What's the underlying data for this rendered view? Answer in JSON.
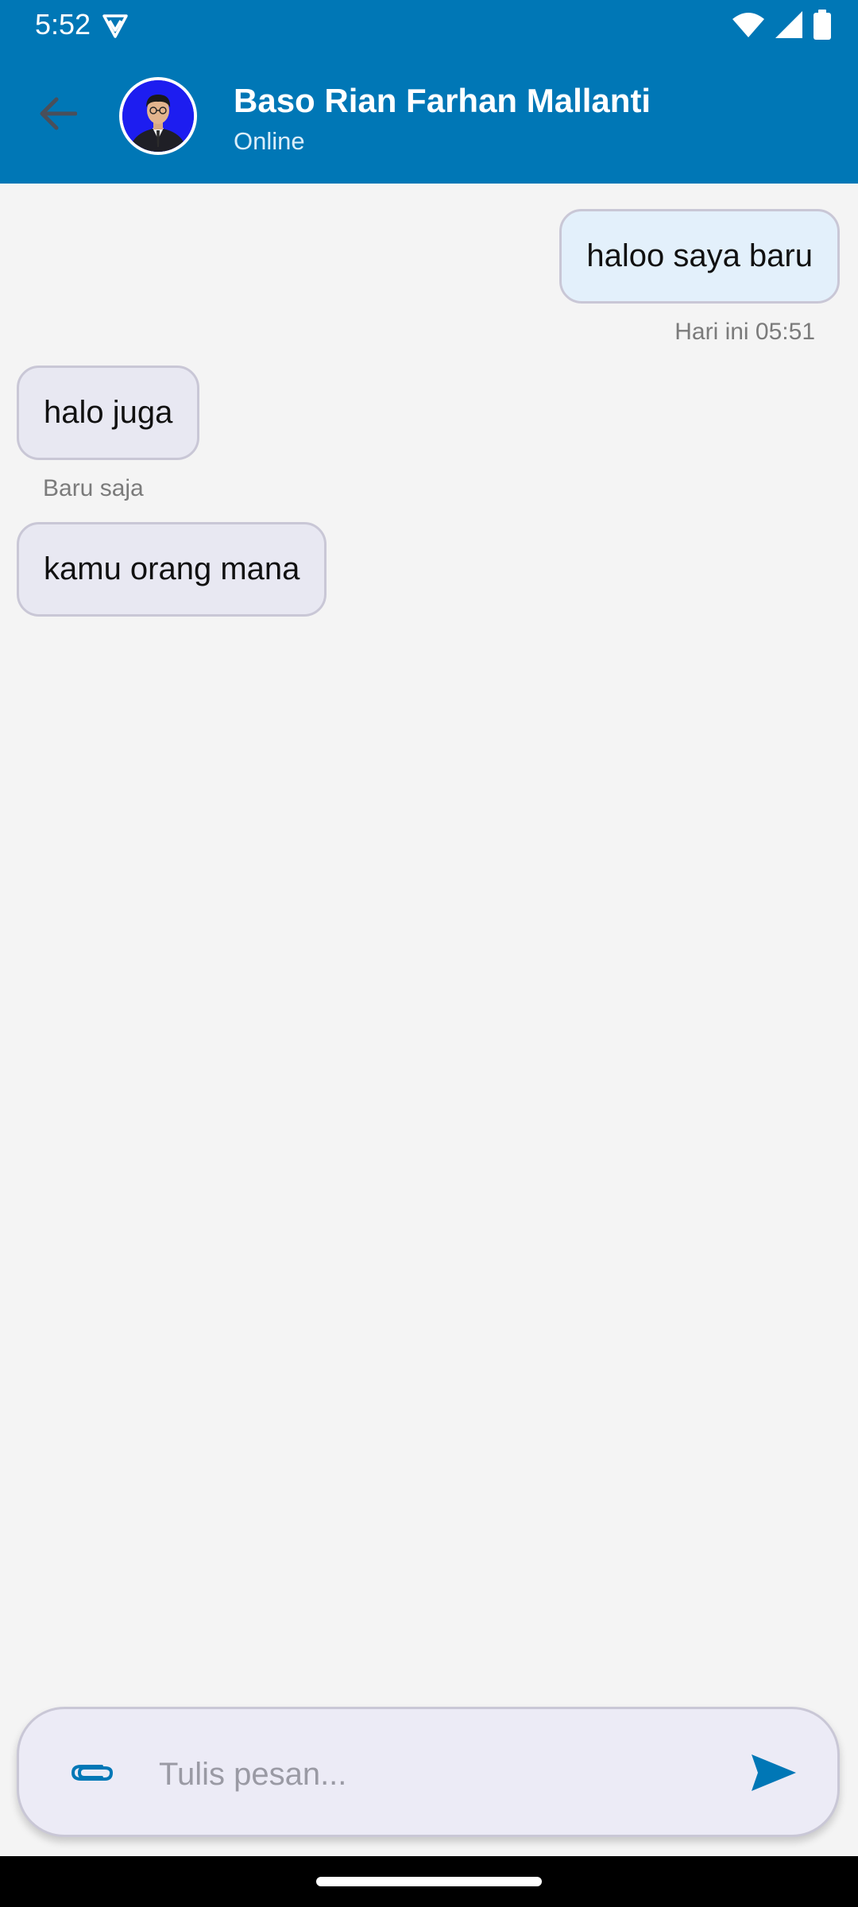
{
  "status_bar": {
    "time": "5:52",
    "vpn_icon": "shield-v-icon",
    "wifi_icon": "wifi-icon",
    "signal_icon": "cell-signal-icon",
    "battery_icon": "battery-icon"
  },
  "app_bar": {
    "back_icon": "arrow-back-icon",
    "contact_name": "Baso Rian Farhan Mallanti",
    "contact_status": "Online",
    "accent_color": "#0077b6"
  },
  "messages": [
    {
      "direction": "sent",
      "text": "haloo saya baru",
      "meta": "Hari ini 05:51"
    },
    {
      "direction": "received",
      "text": "halo juga",
      "meta": "Baru saja"
    },
    {
      "direction": "received",
      "text": "kamu orang mana",
      "meta": ""
    }
  ],
  "composer": {
    "placeholder": "Tulis pesan...",
    "value": "",
    "attach_icon": "paperclip-icon",
    "send_icon": "send-icon"
  }
}
